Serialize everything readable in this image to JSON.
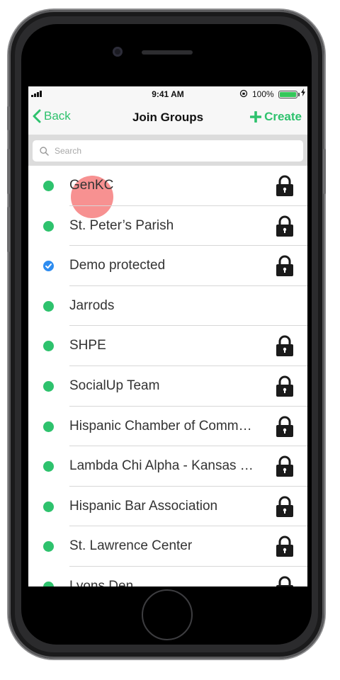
{
  "statusbar": {
    "time": "9:41 AM",
    "battery_pct": "100%"
  },
  "navbar": {
    "back_label": "Back",
    "title": "Join Groups",
    "create_label": "Create"
  },
  "search": {
    "placeholder": "Search"
  },
  "colors": {
    "accent": "#2ec26d",
    "checked": "#2d8cf0",
    "touch": "#f46c6c"
  },
  "groups": [
    {
      "name": "GenKC",
      "status": "dot",
      "locked": true
    },
    {
      "name": "St. Peter’s Parish",
      "status": "dot",
      "locked": true
    },
    {
      "name": "Demo protected",
      "status": "check",
      "locked": true
    },
    {
      "name": "Jarrods",
      "status": "dot",
      "locked": false
    },
    {
      "name": "SHPE",
      "status": "dot",
      "locked": true
    },
    {
      "name": "SocialUp Team",
      "status": "dot",
      "locked": true
    },
    {
      "name": "Hispanic Chamber of Comm…",
      "status": "dot",
      "locked": true
    },
    {
      "name": "Lambda Chi Alpha - Kansas …",
      "status": "dot",
      "locked": true
    },
    {
      "name": "Hispanic Bar Association",
      "status": "dot",
      "locked": true
    },
    {
      "name": "St. Lawrence Center",
      "status": "dot",
      "locked": true
    },
    {
      "name": "Lyons Den",
      "status": "dot",
      "locked": true
    }
  ],
  "icons": {
    "back": "chevron-left-icon",
    "create": "plus-icon",
    "search": "search-icon",
    "lock": "lock-icon",
    "check": "checkmark-icon"
  }
}
